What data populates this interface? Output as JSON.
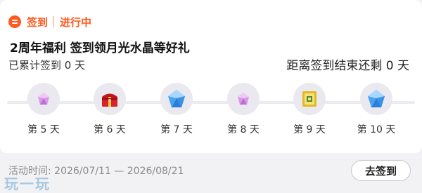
{
  "header": {
    "label": "签到",
    "status": "进行中",
    "accent_color": "#ff5a1f"
  },
  "title": "2周年福利 签到领月光水晶等好礼",
  "accumulated": "已累计签到 0 天",
  "remaining": "距离签到结束还剩 0 天",
  "days": [
    {
      "label": "第 5 天",
      "icon": "small-purple-crystal-icon"
    },
    {
      "label": "第 6 天",
      "icon": "red-chest-icon"
    },
    {
      "label": "第 7 天",
      "icon": "blue-crystal-icon"
    },
    {
      "label": "第 8 天",
      "icon": "small-purple-crystal-icon"
    },
    {
      "label": "第 9 天",
      "icon": "gold-box-icon"
    },
    {
      "label": "第 10 天",
      "icon": "blue-crystal-icon"
    }
  ],
  "footer": {
    "time": "活动时间: 2026/07/11 — 2026/08/21",
    "button": "去签到"
  },
  "watermark": "玩一玩"
}
